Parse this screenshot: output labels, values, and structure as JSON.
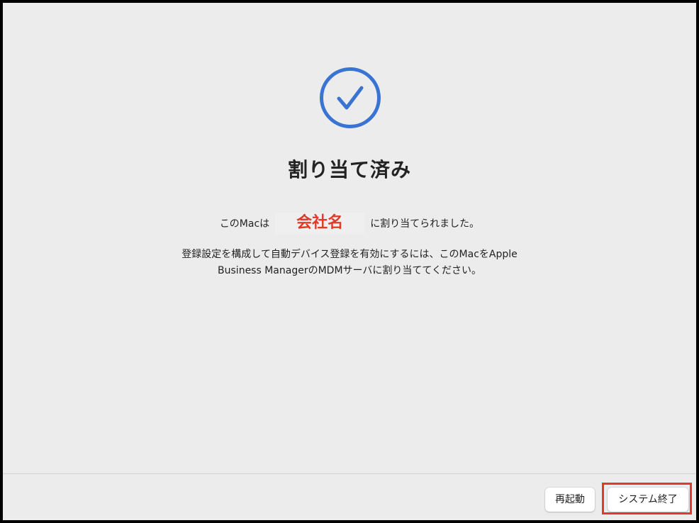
{
  "dialog": {
    "title": "割り当て済み",
    "assigned_prefix": "このMacは",
    "organization": "会社名",
    "assigned_suffix": "に割り当てられました。",
    "description_line1": "登録設定を構成して自動デバイス登録を有効にするには、このMacをApple",
    "description_line2": "Business ManagerのMDMサーバに割り当ててください。",
    "status_icon": "checkmark-circle-icon"
  },
  "footer": {
    "restart_label": "再起動",
    "shutdown_label": "システム終了"
  },
  "colors": {
    "accent": "#3a74d2",
    "annotation": "#e03a2a",
    "background": "#ececec"
  }
}
